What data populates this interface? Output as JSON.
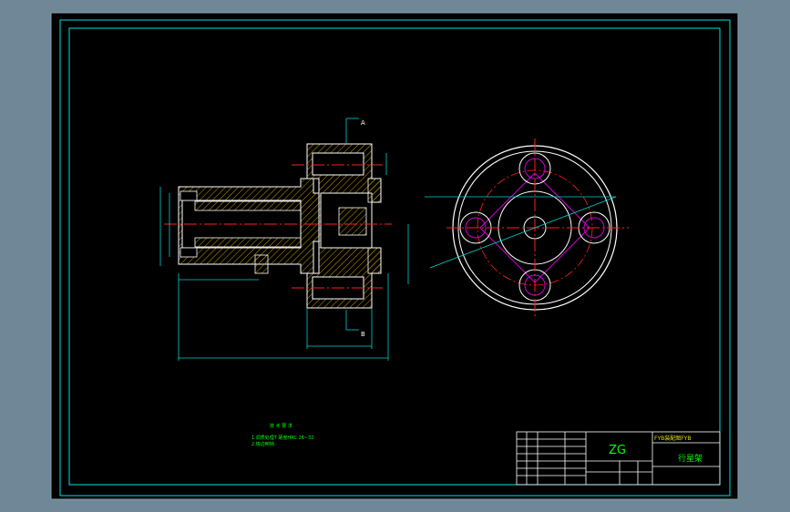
{
  "colors": {
    "background": "#6f8797",
    "paper": "#000000",
    "border": "#00e0e0",
    "part": "#ffffff",
    "hatch": "#c8a000",
    "centerline": "#ff2020",
    "dimension": "#00d0d0",
    "text": "#00ff00",
    "magenta": "#d000d0",
    "yellow_text": "#e0e000"
  },
  "drawing": {
    "view_label_top": "A",
    "view_label_bottom": "B",
    "notes_title": "技 术 要 求",
    "notes_line1": "1.调质处理T 硬度HRC 26~32",
    "notes_line2": "2.锐边倒钝"
  },
  "title_block": {
    "material": "ZG",
    "part_name": "行星架",
    "header_code": "FYB装配图FYB"
  }
}
